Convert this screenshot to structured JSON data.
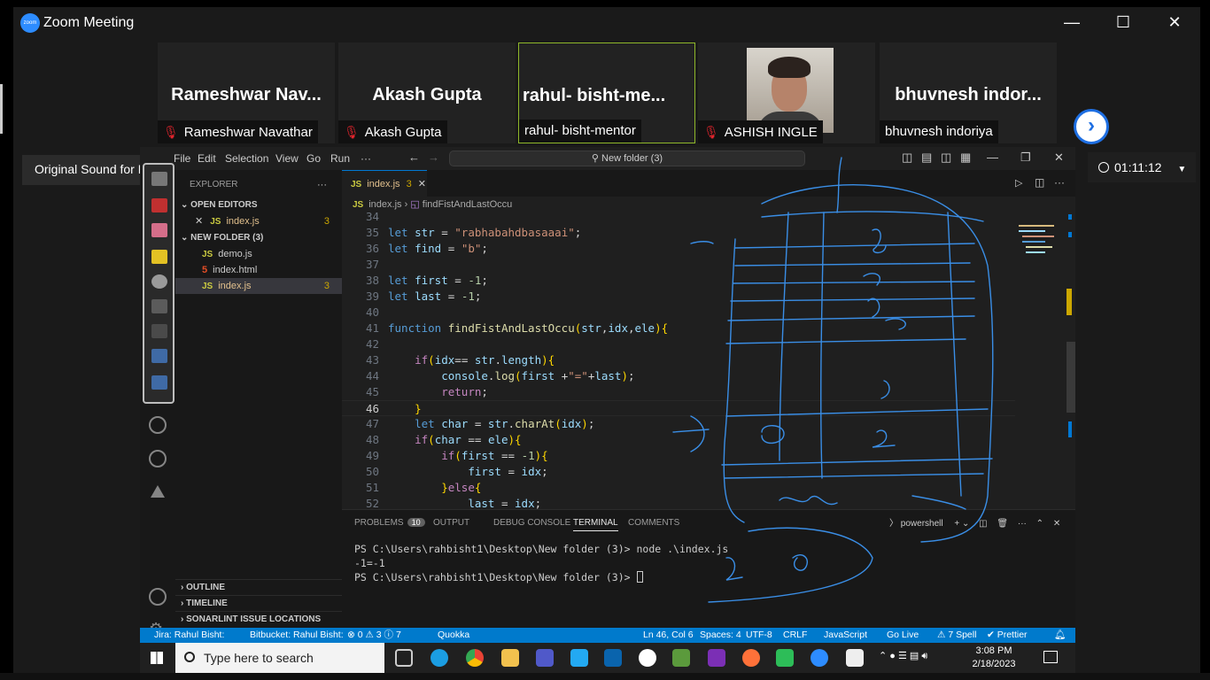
{
  "zoom": {
    "window_title": "Zoom Meeting",
    "logo_text": "zoom",
    "participants": [
      {
        "display_name": "Rameshwar Nav...",
        "name_label": "Rameshwar Navathar",
        "muted": true
      },
      {
        "display_name": "Akash Gupta",
        "name_label": "Akash Gupta",
        "muted": true
      },
      {
        "display_name": "rahul- bisht-me...",
        "name_label": "rahul- bisht-mentor",
        "muted": false
      },
      {
        "display_name": "",
        "name_label": "ASHISH INGLE",
        "muted": true
      },
      {
        "display_name": "bhuvnesh indor...",
        "name_label": "bhuvnesh indoriya",
        "muted": false
      }
    ],
    "original_sound": "Original Sound for Musicians: Off",
    "timer": "01:11:12"
  },
  "vscode": {
    "menu": [
      "File",
      "Edit",
      "Selection",
      "View",
      "Go",
      "Run",
      "···"
    ],
    "search_box": "New folder (3)",
    "explorer_title": "EXPLORER",
    "open_editors_title": "OPEN EDITORS",
    "open_editor_file": "index.js",
    "open_editor_badge": "3",
    "folder_title": "NEW FOLDER (3)",
    "files": [
      {
        "name": "demo.js",
        "type": "JS",
        "badge": ""
      },
      {
        "name": "index.html",
        "type": "HTML",
        "badge": ""
      },
      {
        "name": "index.js",
        "type": "JS",
        "badge": "3"
      }
    ],
    "outline_sections": [
      "OUTLINE",
      "TIMELINE",
      "SONARLINT ISSUE LOCATIONS"
    ],
    "tab": {
      "name": "index.js",
      "badge": "3"
    },
    "breadcrumb": [
      "index.js",
      "findFistAndLastOccu"
    ],
    "code_lines": [
      {
        "n": "34",
        "text": ""
      },
      {
        "n": "35",
        "text": "let str = \"rabhabahdbasaaai\";"
      },
      {
        "n": "36",
        "text": "let find = \"b\";"
      },
      {
        "n": "37",
        "text": ""
      },
      {
        "n": "38",
        "text": "let first = -1;"
      },
      {
        "n": "39",
        "text": "let last = -1;"
      },
      {
        "n": "40",
        "text": ""
      },
      {
        "n": "41",
        "text": "function findFistAndLastOccu(str,idx,ele){"
      },
      {
        "n": "42",
        "text": ""
      },
      {
        "n": "43",
        "text": "    if(idx== str.length){"
      },
      {
        "n": "44",
        "text": "        console.log(first +\"=\"+last);"
      },
      {
        "n": "45",
        "text": "        return;"
      },
      {
        "n": "46",
        "text": "    }"
      },
      {
        "n": "47",
        "text": "    let char = str.charAt(idx);"
      },
      {
        "n": "48",
        "text": "    if(char == ele){"
      },
      {
        "n": "49",
        "text": "        if(first == -1){"
      },
      {
        "n": "50",
        "text": "            first = idx;"
      },
      {
        "n": "51",
        "text": "        }else{"
      },
      {
        "n": "52",
        "text": "            last = idx;"
      }
    ],
    "panel_tabs": [
      "PROBLEMS",
      "OUTPUT",
      "DEBUG CONSOLE",
      "TERMINAL",
      "COMMENTS"
    ],
    "problems_count": "10",
    "active_panel_tab": "TERMINAL",
    "terminal_shell": "powershell",
    "terminal_lines": [
      "PS C:\\Users\\rahbisht1\\Desktop\\New folder (3)> node .\\index.js",
      "-1=-1",
      "PS C:\\Users\\rahbisht1\\Desktop\\New folder (3)> "
    ],
    "status": {
      "jira": "Jira: Rahul Bisht:",
      "bitbucket": "Bitbucket: Rahul Bisht:",
      "problems": "⊗ 0  ⚠ 3  ⓘ 7",
      "quokka": "Quokka",
      "position": "Ln 46, Col 6",
      "spaces": "Spaces: 4",
      "encoding": "UTF-8",
      "eol": "CRLF",
      "language": "JavaScript",
      "golive": "Go Live",
      "spell": "⚠ 7 Spell",
      "prettier": "✔ Prettier"
    }
  },
  "taskbar": {
    "search_placeholder": "Type here to search",
    "time": "3:08 PM",
    "date": "2/18/2023"
  }
}
